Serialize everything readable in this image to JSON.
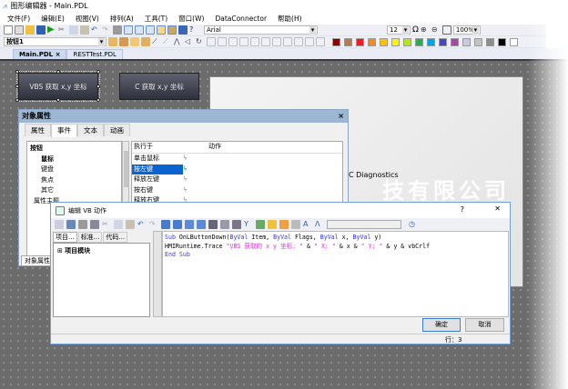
{
  "window": {
    "title": "图形编辑器 - Main.PDL"
  },
  "menu": [
    "文件(F)",
    "编辑(E)",
    "视图(V)",
    "排列(A)",
    "工具(T)",
    "窗口(W)",
    "DataConnector",
    "帮助(H)"
  ],
  "toolbar": {
    "font": "Arial",
    "font_size": "12",
    "zoom": "100%",
    "object_select": "按钮1",
    "omega": "Ω"
  },
  "palette": [
    "#8b0000",
    "#b97a4a",
    "#ee1c24",
    "#f7891e",
    "#fdc010",
    "#fff200",
    "#b5e61d",
    "#22b14c",
    "#00a2e8",
    "#3f48cc",
    "#a349a4",
    "#c8c8e8",
    "#c3c3c3",
    "#8c8c8c",
    "#000000",
    "#ffffff"
  ],
  "doc_tabs": [
    {
      "label": "Main.PDL",
      "close": "×"
    },
    {
      "label": "RESTTest.PDL"
    }
  ],
  "canvas": {
    "button1": "VBS 获取 x,y 坐标",
    "button2": "C 获取 x,y 坐标",
    "panel_text": "C Diagnostics",
    "watermark": "技有限公司"
  },
  "props": {
    "title": "对象属性",
    "close": "×",
    "tabs": [
      "属性",
      "事件",
      "文本",
      "动画"
    ],
    "tree": [
      "按钮",
      "鼠标",
      "键盘",
      "焦点",
      "其它",
      "属性主题"
    ],
    "col_exec": "执行于",
    "col_action": "动作",
    "events": [
      "单击鼠标",
      "按左键",
      "释放左键",
      "按右键",
      "释放右键"
    ],
    "footer_tab": "对象属性"
  },
  "vbs": {
    "title": "编辑 VB 动作",
    "help": "?",
    "close": "✕",
    "tabs": [
      "项目...",
      "标准...",
      "代码..."
    ],
    "tree_root": "项目模块",
    "code": {
      "l1_kw1": "Sub",
      "l1_a": " OnLButtonDown(",
      "l1_kw2": "ByVal",
      "l1_b": " Item, ",
      "l1_kw3": "ByVal",
      "l1_c": " Flags, ",
      "l1_kw4": "ByVal",
      "l1_d": " x, ",
      "l1_kw5": "ByVal",
      "l1_e": " y)",
      "l2_a": "HMIRuntime.Trace ",
      "l2_s1": "\"VBS 获取的 x y 坐标: \"",
      "l2_b": " & ",
      "l2_s2": "\" X: \"",
      "l2_c": " & x & ",
      "l2_s3": "\" Y: \"",
      "l2_d": " & y & vbCrlf",
      "l3": "End Sub"
    },
    "ok": "确定",
    "cancel": "取消",
    "status": "行：3"
  }
}
